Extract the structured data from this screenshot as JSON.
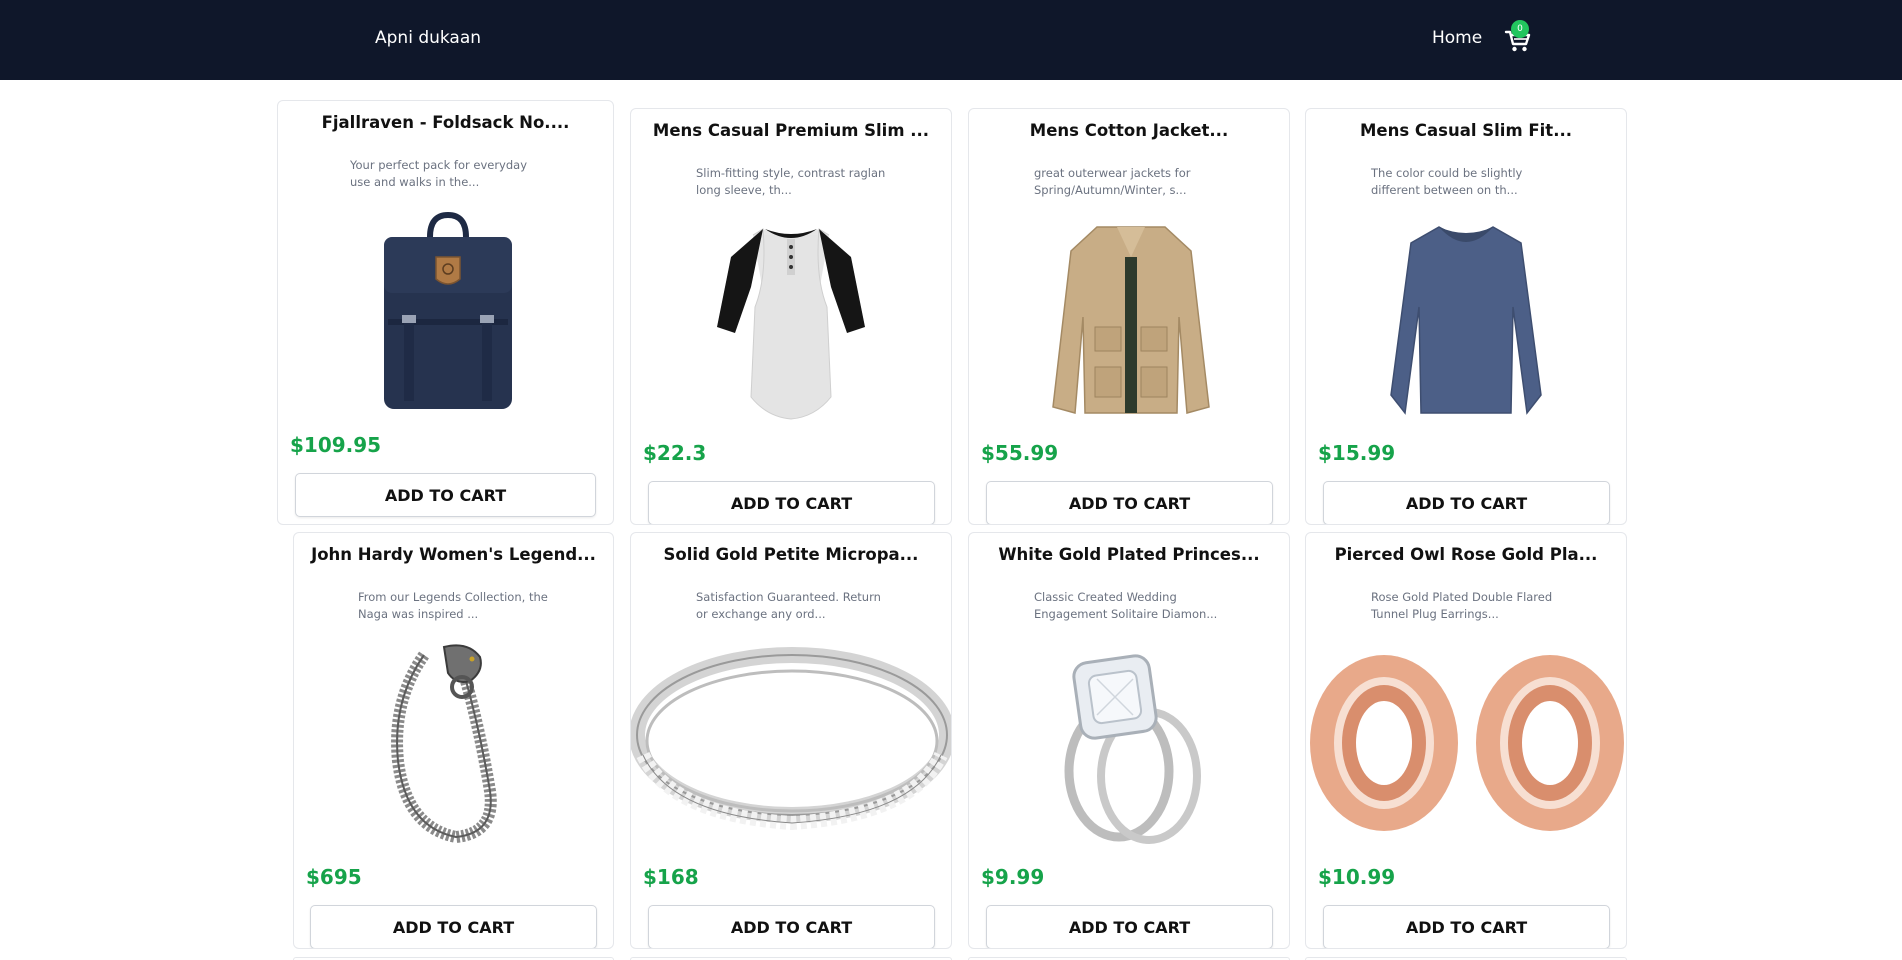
{
  "navbar": {
    "brand": "Apni dukaan",
    "home_label": "Home",
    "cart_count": "0",
    "cart_icon": "shopping-cart-icon",
    "background_color": "#0f172a",
    "badge_color": "#22c55e"
  },
  "price_color": "#16a34a",
  "products": [
    {
      "title": "Fjallraven - Foldsack No....",
      "description": "Your perfect pack for everyday use and walks in the...",
      "price": "$109.95",
      "button_label": "ADD TO CART",
      "image": "backpack-image"
    },
    {
      "title": "Mens Casual Premium Slim ...",
      "description": "Slim-fitting style, contrast raglan long sleeve, th...",
      "price": "$22.3",
      "button_label": "ADD TO CART",
      "image": "raglan-tshirt-image"
    },
    {
      "title": "Mens Cotton Jacket...",
      "description": "great outerwear jackets for Spring/Autumn/Winter, s...",
      "price": "$55.99",
      "button_label": "ADD TO CART",
      "image": "cotton-jacket-image"
    },
    {
      "title": "Mens Casual Slim Fit...",
      "description": "The color could be slightly different between on th...",
      "price": "$15.99",
      "button_label": "ADD TO CART",
      "image": "long-sleeve-shirt-image"
    },
    {
      "title": "John Hardy Women's Legend...",
      "description": "From our Legends Collection, the Naga was inspired ...",
      "price": "$695",
      "button_label": "ADD TO CART",
      "image": "dragon-bracelet-image"
    },
    {
      "title": "Solid Gold Petite Micropa...",
      "description": "Satisfaction Guaranteed. Return or exchange any ord...",
      "price": "$168",
      "button_label": "ADD TO CART",
      "image": "diamond-band-ring-image"
    },
    {
      "title": "White Gold Plated Princes...",
      "description": "Classic Created Wedding Engagement Solitaire Diamon...",
      "price": "$9.99",
      "button_label": "ADD TO CART",
      "image": "engagement-ring-image"
    },
    {
      "title": "Pierced Owl Rose Gold Pla...",
      "description": "Rose Gold Plated Double Flared Tunnel Plug Earrings...",
      "price": "$10.99",
      "button_label": "ADD TO CART",
      "image": "rose-gold-plugs-image"
    }
  ]
}
